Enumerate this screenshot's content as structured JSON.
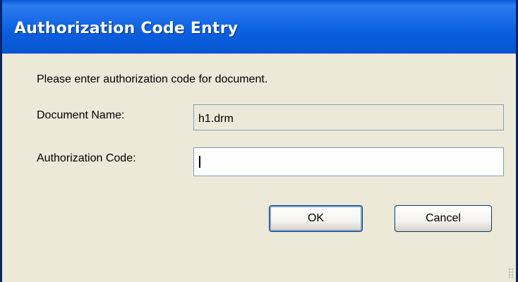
{
  "window": {
    "title": "Authorization Code Entry"
  },
  "dialog": {
    "intro_text": "Please enter authorization code for document.",
    "document_name_label": "Document Name:",
    "document_name_value": "h1.drm",
    "authorization_code_label": "Authorization Code:",
    "authorization_code_value": ""
  },
  "buttons": {
    "ok_label": "OK",
    "cancel_label": "Cancel"
  },
  "colors": {
    "title_bar": "#0a5fe0",
    "dialog_background": "#ece9d8",
    "button_border": "#003c74"
  }
}
